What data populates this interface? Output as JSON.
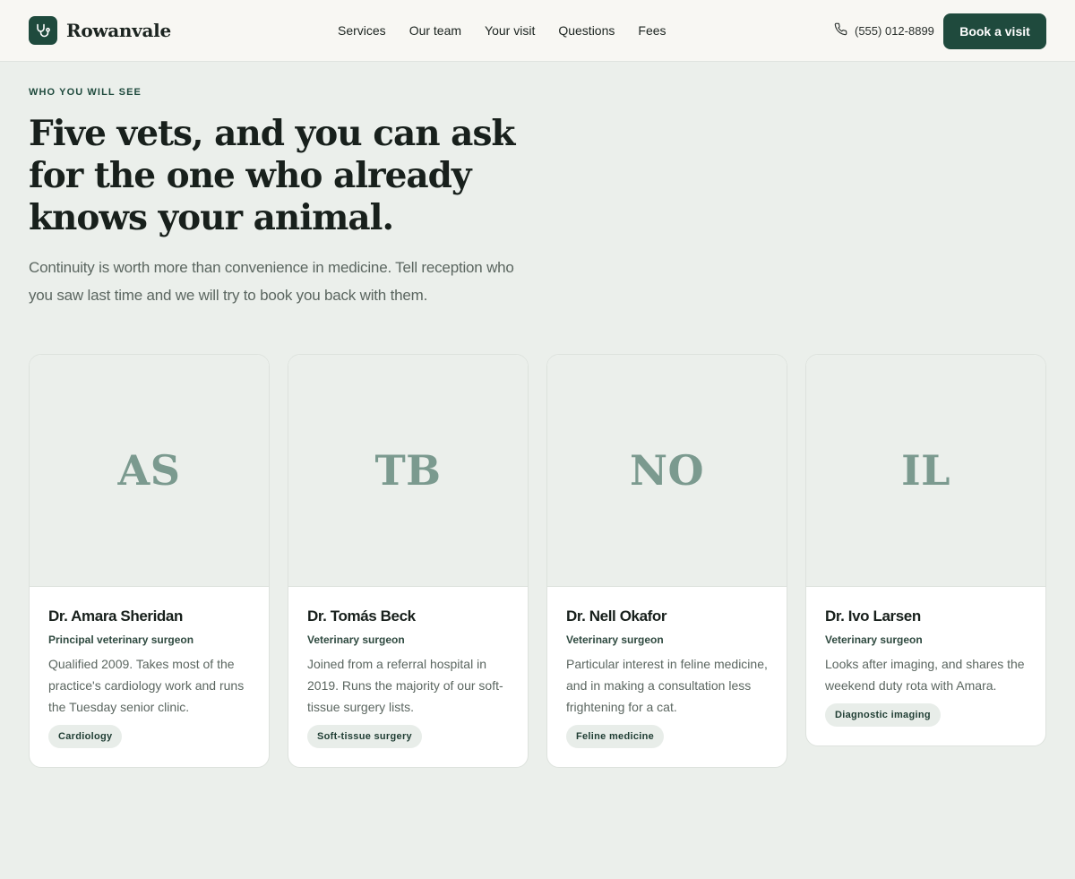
{
  "brand": {
    "name": "Rowanvale",
    "icon": "stethoscope-icon"
  },
  "nav": {
    "items": [
      "Services",
      "Our team",
      "Your visit",
      "Questions",
      "Fees"
    ]
  },
  "contact": {
    "phone": "(555) 012-8899",
    "icon": "phone-icon"
  },
  "cta": {
    "book_label": "Book a visit"
  },
  "hero": {
    "eyebrow": "WHO YOU WILL SEE",
    "headline": "Five vets, and you can ask for the one who already knows your animal.",
    "lede": "Continuity is worth more than convenience in medicine. Tell reception who you saw last time and we will try to book you back with them."
  },
  "vets": [
    {
      "initials": "AS",
      "name": "Dr. Amara Sheridan",
      "role": "Principal veterinary surgeon",
      "bio": "Qualified 2009. Takes most of the practice's cardiology work and runs the Tuesday senior clinic.",
      "tag": "Cardiology"
    },
    {
      "initials": "TB",
      "name": "Dr. Tomás Beck",
      "role": "Veterinary surgeon",
      "bio": "Joined from a referral hospital in 2019. Runs the majority of our soft-tissue surgery lists.",
      "tag": "Soft-tissue surgery"
    },
    {
      "initials": "NO",
      "name": "Dr. Nell Okafor",
      "role": "Veterinary surgeon",
      "bio": "Particular interest in feline medicine, and in making a consultation less frightening for a cat.",
      "tag": "Feline medicine"
    },
    {
      "initials": "IL",
      "name": "Dr. Ivo Larsen",
      "role": "Veterinary surgeon",
      "bio": "Looks after imaging, and shares the weekend duty rota with Amara.",
      "tag": "Diagnostic imaging"
    }
  ],
  "colors": {
    "brand": "#1f4a3d",
    "background": "#ebefeb",
    "header": "#f8f7f3",
    "initials": "#7b9a8f"
  }
}
